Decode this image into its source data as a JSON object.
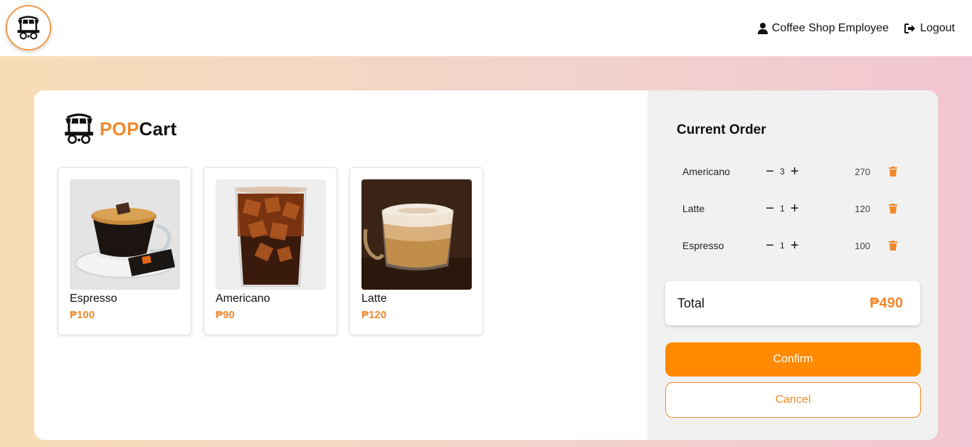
{
  "header": {
    "user_label": "Coffee Shop Employee",
    "logout_label": "Logout"
  },
  "brand": {
    "pop": "POP",
    "cart": "Cart"
  },
  "products": [
    {
      "name": "Espresso",
      "price": "₱100"
    },
    {
      "name": "Americano",
      "price": "₱90"
    },
    {
      "name": "Latte",
      "price": "₱120"
    }
  ],
  "order": {
    "title": "Current Order",
    "items": [
      {
        "name": "Americano",
        "qty": "3",
        "total": "270"
      },
      {
        "name": "Latte",
        "qty": "1",
        "total": "120"
      },
      {
        "name": "Espresso",
        "qty": "1",
        "total": "100"
      }
    ],
    "total_label": "Total",
    "total_value": "₱490",
    "confirm_label": "Confirm",
    "cancel_label": "Cancel"
  },
  "colors": {
    "accent": "#f0892c",
    "confirm": "#ff8a00"
  },
  "icons": [
    "cart-logo-icon",
    "user-icon",
    "logout-icon",
    "minus-icon",
    "plus-icon",
    "trash-icon"
  ]
}
